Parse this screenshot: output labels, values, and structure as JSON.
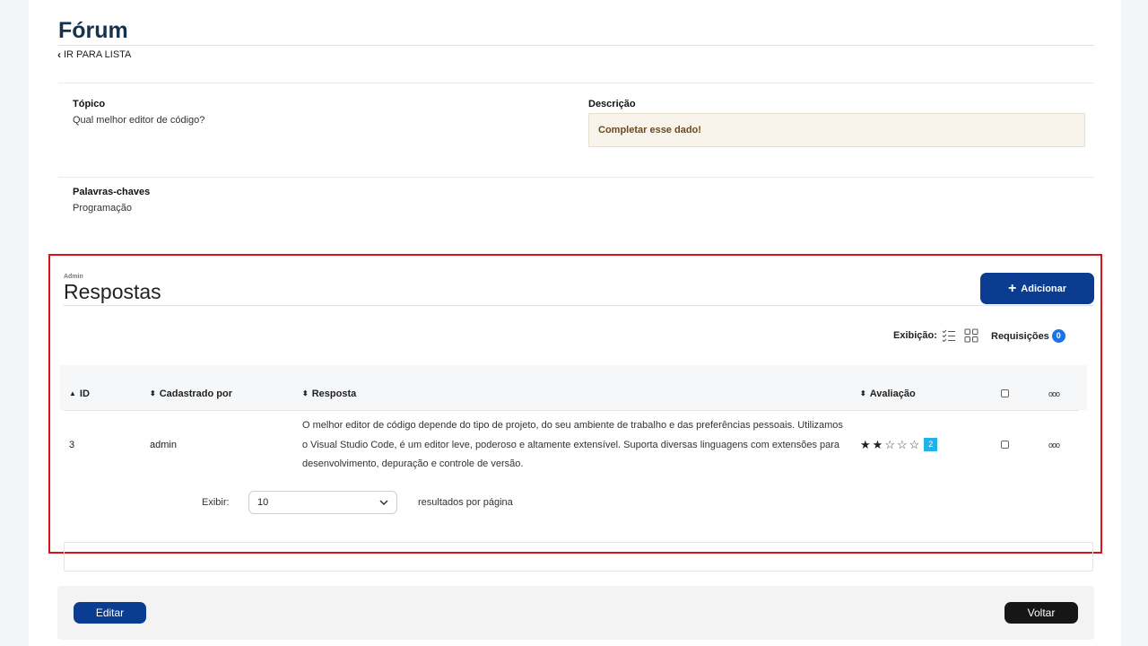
{
  "header": {
    "title": "Fórum",
    "back_link": "IR PARA LISTA"
  },
  "details": {
    "topic_label": "Tópico",
    "topic_value": "Qual melhor editor de código?",
    "description_label": "Descrição",
    "description_value": "Completar esse dado!",
    "keywords_label": "Palavras-chaves",
    "keywords_value": "Programação"
  },
  "responses": {
    "admin_label": "Admin",
    "title": "Respostas",
    "add_button": "Adicionar",
    "display_label": "Exibição:",
    "requests_label": "Requisições",
    "requests_count": "0",
    "columns": {
      "id": "ID",
      "registered_by": "Cadastrado por",
      "answer": "Resposta",
      "rating": "Avaliação"
    },
    "rows": [
      {
        "id": "3",
        "registered_by": "admin",
        "answer": "O melhor editor de código depende do tipo de projeto, do seu ambiente de trabalho e das preferências pessoais. Utilizamos o Visual Studio Code, é um editor leve, poderoso e altamente extensível. Suporta diversas linguagens com extensões para desenvolvimento, depuração e controle de versão.",
        "rating": 2,
        "rating_max": 5,
        "rating_count": "2"
      }
    ],
    "pagination": {
      "show_label": "Exibir:",
      "per_page_value": "10",
      "suffix": "resultados por página"
    }
  },
  "footer": {
    "edit_button": "Editar",
    "back_button": "Voltar"
  },
  "colors": {
    "primary": "#0a3d91",
    "highlight_frame": "#d9141a",
    "badge_blue": "#1a73e8",
    "badge_cyan": "#20b3e8"
  },
  "icons": [
    "chevron-left-icon",
    "plus-icon",
    "list-view-icon",
    "grid-view-icon",
    "sort-icon",
    "star-icon",
    "more-options-icon",
    "chevron-down-icon"
  ]
}
